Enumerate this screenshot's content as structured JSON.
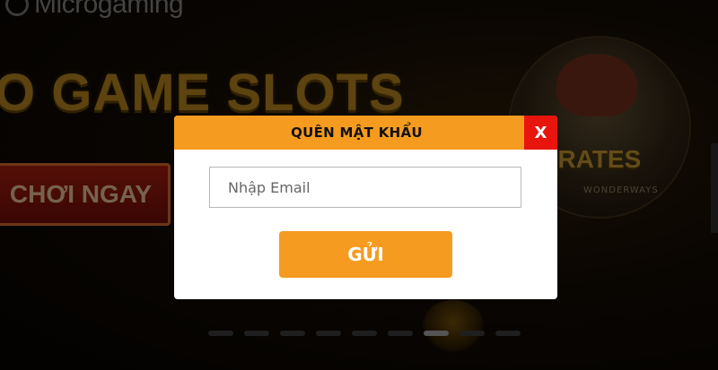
{
  "background": {
    "logo_text": "Microgaming",
    "headline": "O GAME SLOTS",
    "cta_label": "CHƠI NGAY",
    "game_title": "PIRATES",
    "game_subtitle": "WONDERWAYS",
    "slider_dots": 9,
    "active_dot": 7
  },
  "modal": {
    "title": "QUÊN MẬT KHẨU",
    "close_label": "X",
    "email_placeholder": "Nhập Email",
    "email_value": "",
    "submit_label": "GỬI"
  },
  "colors": {
    "accent": "#f59b1f",
    "close": "#e8150c"
  }
}
